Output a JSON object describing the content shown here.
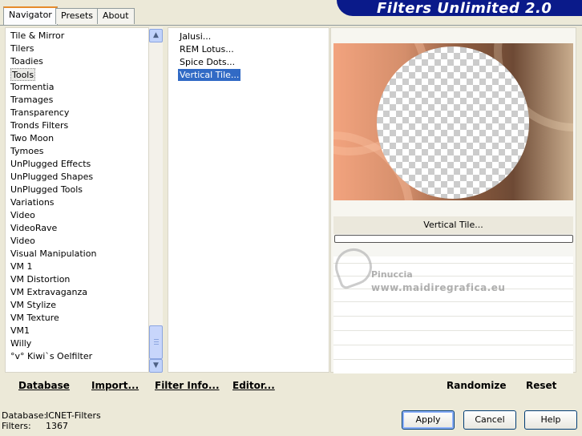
{
  "tabs": [
    {
      "label": "Navigator",
      "active": true
    },
    {
      "label": "Presets",
      "active": false
    },
    {
      "label": "About",
      "active": false
    }
  ],
  "brand_title": "Filters Unlimited 2.0",
  "categories": [
    "Tile & Mirror",
    "Tilers",
    "Toadies",
    "Tools",
    "Tormentia",
    "Tramages",
    "Transparency",
    "Tronds Filters",
    "Two Moon",
    "Tymoes",
    "UnPlugged Effects",
    "UnPlugged Shapes",
    "UnPlugged Tools",
    "Variations",
    "Video",
    "VideoRave",
    "Video",
    "Visual Manipulation",
    "VM 1",
    "VM Distortion",
    "VM Extravaganza",
    "VM Stylize",
    "VM Texture",
    "VM1",
    "Willy",
    "°v° Kiwi`s Oelfilter"
  ],
  "selected_category": "Tools",
  "filters": [
    "Jalusi...",
    "REM Lotus...",
    "Spice Dots...",
    "Vertical Tile..."
  ],
  "selected_filter": "Vertical Tile...",
  "links": {
    "database": "Database",
    "import": "Import...",
    "filter_info": "Filter Info...",
    "editor": "Editor...",
    "randomize": "Randomize",
    "reset": "Reset"
  },
  "preview_filter_label": "Vertical Tile...",
  "watermark": {
    "line1": "Pinuccia",
    "line2": "www.maidiregrafica.eu"
  },
  "status": {
    "database_label": "Database:",
    "database_value": "ICNET-Filters",
    "filters_label": "Filters:",
    "filters_value": "1367"
  },
  "buttons": {
    "apply": "Apply",
    "cancel": "Cancel",
    "help": "Help"
  },
  "colors": {
    "selection": "#316ac5",
    "brand_bg": "#0a1a8a",
    "window_bg": "#ece9d8"
  }
}
